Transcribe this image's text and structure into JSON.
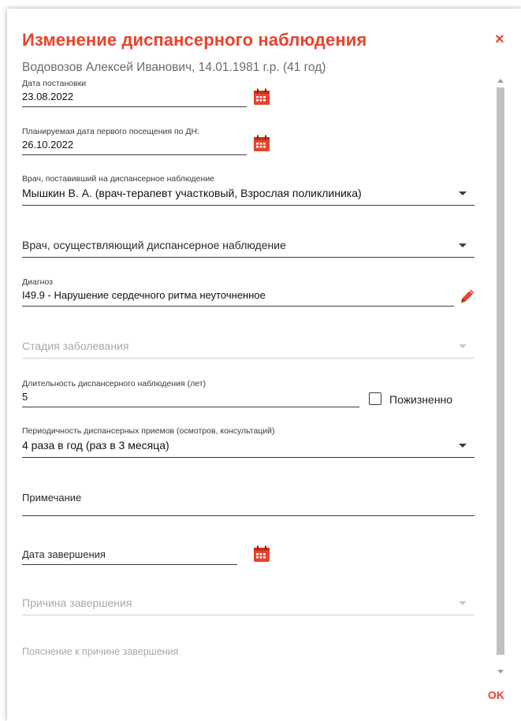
{
  "dialog": {
    "title": "Изменение диспансерного наблюдения",
    "subtitle": "Водовозов Алексей Иванович, 14.01.1981 г.р. (41 год)",
    "close_label": "×",
    "ok_label": "OK"
  },
  "fields": {
    "registration_date": {
      "label": "Дата постановки",
      "value": "23.08.2022"
    },
    "first_visit_date": {
      "label": "Планируемая дата первого посещения по ДН:",
      "value": "26.10.2022"
    },
    "registering_doctor": {
      "label": "Врач, поставивший на диспансерное наблюдение",
      "value": "Мышкин В. А. (врач-терапевт участковый, Взрослая поликлиника)"
    },
    "observing_doctor": {
      "placeholder": "Врач, осуществляющий диспансерное наблюдение"
    },
    "diagnosis": {
      "label": "Диагноз",
      "value": "I49.9 - Нарушение сердечного ритма неуточненное"
    },
    "disease_stage": {
      "placeholder": "Стадия заболевания"
    },
    "duration": {
      "label": "Длительность диспансерного наблюдения (лет)",
      "value": "5"
    },
    "lifelong": {
      "label": "Пожизненно",
      "checked": false
    },
    "periodicity": {
      "label": "Периодичность диспансерных приемов (осмотров, консультаций)",
      "value": "4 раза в год (раз в 3 месяца)"
    },
    "note": {
      "placeholder": "Примечание"
    },
    "end_date": {
      "placeholder": "Дата завершения"
    },
    "end_reason": {
      "placeholder": "Причина завершения"
    },
    "end_reason_explanation": {
      "placeholder": "Пояснение к причине завершения"
    }
  },
  "icons": {
    "calendar": "calendar-icon",
    "pencil": "pencil-icon",
    "dropdown": "chevron-down-icon"
  },
  "colors": {
    "accent": "#e8432d",
    "text": "#212121",
    "muted": "#a9a9a9"
  }
}
